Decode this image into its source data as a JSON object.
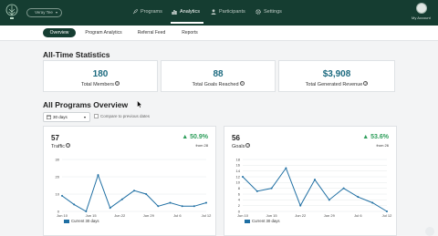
{
  "topbar": {
    "store_select": "Veray Tee",
    "nav": [
      {
        "label": "Programs",
        "icon": "rocket-icon"
      },
      {
        "label": "Analytics",
        "icon": "bar-chart-icon"
      },
      {
        "label": "Participants",
        "icon": "person-icon"
      },
      {
        "label": "Settings",
        "icon": "gear-icon"
      }
    ],
    "account_label": "My Account"
  },
  "subnav": [
    "Overview",
    "Program Analytics",
    "Referral Feed",
    "Reports"
  ],
  "all_time": {
    "heading": "All-Time Statistics",
    "cards": [
      {
        "value": "180",
        "label": "Total Members"
      },
      {
        "value": "88",
        "label": "Total Goals Reached"
      },
      {
        "value": "$3,908",
        "label": "Total Generated Revenue"
      }
    ]
  },
  "programs": {
    "heading": "All Programs Overview",
    "date_range": "30 days",
    "compare_label": "Compare to previous dates"
  },
  "charts": [
    {
      "total": "57",
      "name": "Traffic",
      "change": "▲ 50.9%",
      "from": "from 28",
      "legend": "Current 30 days",
      "yticks": [
        "30",
        "20",
        "10",
        "0"
      ],
      "xticks": [
        "Jun 10",
        "Jun 15",
        "Jun 22",
        "Jun 29",
        "Jul 6",
        "Jul 12"
      ]
    },
    {
      "total": "56",
      "name": "Goals",
      "change": "▲ 53.6%",
      "from": "from 26",
      "legend": "Current 30 days",
      "yticks": [
        "18",
        "16",
        "14",
        "12",
        "10",
        "8",
        "6",
        "4",
        "2",
        "0"
      ],
      "xticks": [
        "Jun 10",
        "Jun 15",
        "Jun 22",
        "Jun 29",
        "Jul 6",
        "Jul 12"
      ]
    }
  ],
  "chart_data": [
    {
      "type": "line",
      "ylim": [
        0,
        30
      ],
      "x": [
        "Jun 10",
        "Jun 12",
        "Jun 15",
        "Jun 18",
        "Jun 22",
        "Jun 25",
        "Jun 28",
        "Jun 29",
        "Jul 1",
        "Jul 3",
        "Jul 6",
        "Jul 9",
        "Jul 12"
      ],
      "series": [
        {
          "name": "Current 30 days",
          "values": [
            9,
            4,
            0,
            21,
            2,
            7,
            12,
            10,
            3,
            5,
            3,
            3,
            5
          ]
        }
      ],
      "color": "#1f6fa3"
    },
    {
      "type": "line",
      "ylim": [
        0,
        18
      ],
      "x": [
        "Jun 10",
        "Jun 12",
        "Jun 15",
        "Jun 18",
        "Jun 22",
        "Jun 25",
        "Jun 29",
        "Jul 2",
        "Jul 6",
        "Jul 9",
        "Jul 12"
      ],
      "series": [
        {
          "name": "Current 30 days",
          "values": [
            12,
            7,
            8,
            15,
            2,
            11,
            4,
            8,
            5,
            3,
            0
          ]
        }
      ],
      "color": "#1f6fa3"
    }
  ]
}
